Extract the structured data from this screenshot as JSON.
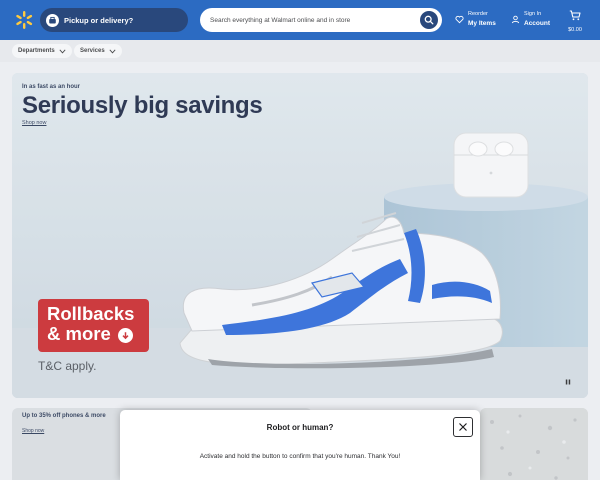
{
  "colors": {
    "header_bg": "#0a53b8",
    "spark_yellow": "#ffc220",
    "pill_dark": "#062a67",
    "rollback_red": "#c41b20",
    "shoe_blue": "#1f5fd6"
  },
  "header": {
    "pickup_label": "Pickup or delivery?",
    "search_placeholder": "Search everything at Walmart online and in store",
    "reorder_small": "Reorder",
    "reorder_big": "My Items",
    "signin_small": "Sign In",
    "signin_big": "Account",
    "cart_amount": "$0.00"
  },
  "subnav": {
    "departments": "Departments",
    "services": "Services"
  },
  "hero": {
    "eyebrow": "In as fast as an hour",
    "headline": "Seriously big savings",
    "shop_link": "Shop now",
    "rollbacks_line1": "Rollbacks",
    "rollbacks_line2": "& more",
    "tc": "T&C apply."
  },
  "tiles": [
    {
      "title": "Up to 35% off phones & more",
      "link": "Shop now"
    }
  ],
  "modal": {
    "title": "Robot or human?",
    "message": "Activate and hold the button to confirm that you're human. Thank You!"
  },
  "icons": [
    "spark-logo-icon",
    "pickup-icon",
    "search-icon",
    "heart-icon",
    "user-icon",
    "cart-icon",
    "chevron-down-icon",
    "arrow-down-circle-icon",
    "pause-icon",
    "close-icon"
  ]
}
